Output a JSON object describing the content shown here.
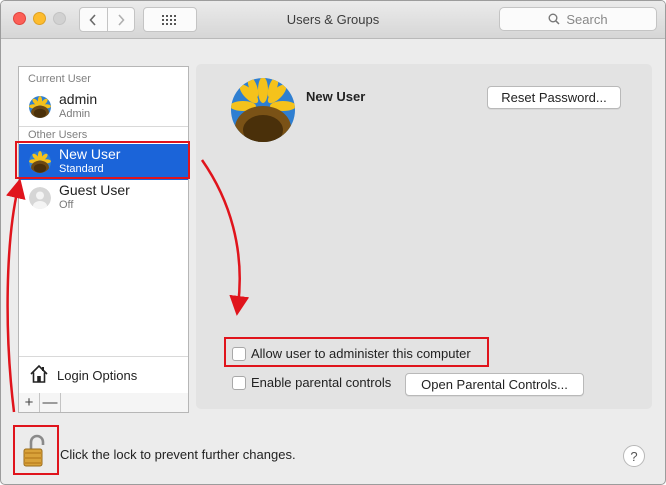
{
  "window": {
    "title": "Users & Groups",
    "search_placeholder": "Search"
  },
  "sidebar": {
    "current_user_label": "Current User",
    "other_users_label": "Other Users",
    "users": [
      {
        "name": "admin",
        "role": "Admin",
        "avatar": "sunflower"
      },
      {
        "name": "New User",
        "role": "Standard",
        "avatar": "sunflower",
        "selected": true
      },
      {
        "name": "Guest User",
        "role": "Off",
        "avatar": "generic-user"
      }
    ],
    "login_options_label": "Login Options",
    "add_label": "+",
    "remove_label": "—"
  },
  "detail": {
    "username": "New User",
    "reset_password_label": "Reset Password...",
    "allow_admin_label": "Allow user to administer this computer",
    "allow_admin_checked": false,
    "parental_controls_label": "Enable parental controls",
    "parental_controls_checked": false,
    "open_parental_controls_label": "Open Parental Controls..."
  },
  "footer": {
    "lock_text": "Click the lock to prevent further changes.",
    "help_label": "?"
  },
  "colors": {
    "selection": "#1b64d9",
    "annotation": "#e0141c"
  }
}
